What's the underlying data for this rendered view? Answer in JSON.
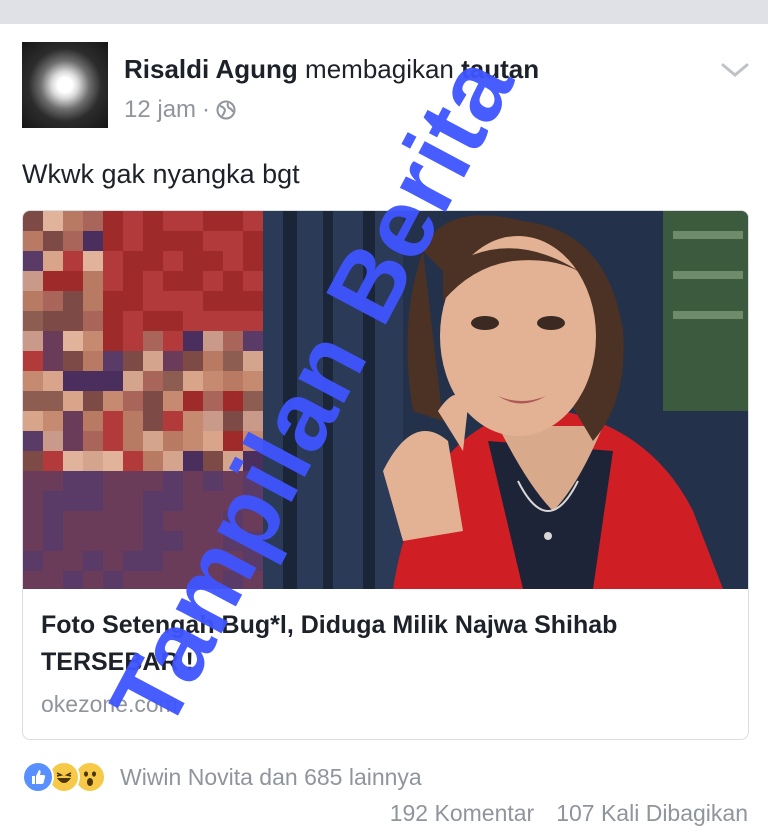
{
  "post": {
    "author": "Risaldi Agung",
    "action": " membagikan ",
    "target": "tautan",
    "time": "12 jam",
    "separator": "·",
    "status_text": "Wkwk gak nyangka bgt"
  },
  "link": {
    "title": "Foto Setengah Bug*l, Diduga Milik Najwa Shihab TERSEBAR !",
    "source": "okezone.com"
  },
  "reactions": {
    "summary": "Wiwin Novita dan 685 lainnya",
    "types": [
      "like-icon",
      "haha-icon",
      "wow-icon"
    ]
  },
  "counts": {
    "comments": "192 Komentar",
    "shares": "107 Kali Dibagikan"
  },
  "watermark": {
    "text": "Tampilan Berita",
    "color": "#3f55ff"
  },
  "colors": {
    "text": "#1d2129",
    "secondary": "#90949c",
    "like": "#5890ff",
    "background": "#e9ebee"
  }
}
